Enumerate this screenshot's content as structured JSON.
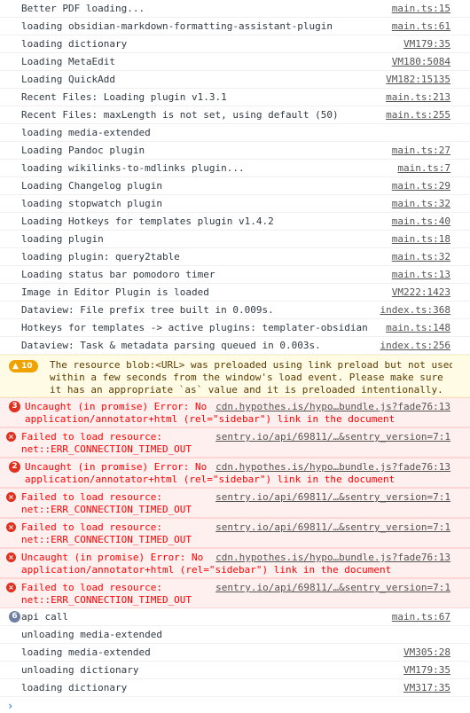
{
  "messages": [
    {
      "type": "log",
      "text": "Better PDF loading...",
      "source": "main.ts:15"
    },
    {
      "type": "log",
      "text": "loading obsidian-markdown-formatting-assistant-plugin",
      "source": "main.ts:61"
    },
    {
      "type": "log",
      "text": "loading dictionary",
      "source": "VM179:35"
    },
    {
      "type": "log",
      "text": "Loading MetaEdit",
      "source": "VM180:5084"
    },
    {
      "type": "log",
      "text": "Loading QuickAdd",
      "source": "VM182:15135"
    },
    {
      "type": "log",
      "text": "Recent Files: Loading plugin v1.3.1",
      "source": "main.ts:213"
    },
    {
      "type": "log",
      "text": "Recent Files: maxLength is not set, using default (50)",
      "source": "main.ts:255"
    },
    {
      "type": "log",
      "text": "loading media-extended",
      "source": ""
    },
    {
      "type": "log",
      "text": "Loading Pandoc plugin",
      "source": "main.ts:27"
    },
    {
      "type": "log",
      "text": "loading wikilinks-to-mdlinks plugin...",
      "source": "main.ts:7"
    },
    {
      "type": "log",
      "text": "Loading Changelog plugin",
      "source": "main.ts:29"
    },
    {
      "type": "log",
      "text": "loading stopwatch plugin",
      "source": "main.ts:32"
    },
    {
      "type": "log",
      "text": "Loading Hotkeys for templates plugin v1.4.2",
      "source": "main.ts:40"
    },
    {
      "type": "log",
      "text": "loading plugin",
      "source": "main.ts:18"
    },
    {
      "type": "log",
      "text": "loading plugin: query2table",
      "source": "main.ts:32"
    },
    {
      "type": "log",
      "text": "Loading status bar pomodoro timer",
      "source": "main.ts:13"
    },
    {
      "type": "log",
      "text": "Image in Editor Plugin is loaded",
      "source": "VM222:1423"
    },
    {
      "type": "log",
      "text": "Dataview: File prefix tree built in 0.009s.",
      "source": "index.ts:368"
    },
    {
      "type": "log",
      "text": "Hotkeys for templates -> active plugins: templater-obsidian",
      "source": "main.ts:148"
    },
    {
      "type": "log",
      "text": "Dataview: Task & metadata parsing queued in 0.003s.",
      "source": "index.ts:256"
    }
  ],
  "warning": {
    "count": "10",
    "lines": [
      "The resource blob:<URL> was preloaded using link preload but not used",
      "within a few seconds from the window's load event. Please make sure",
      "it has an appropriate `as` value and it is preloaded intentionally."
    ]
  },
  "errors": [
    {
      "badge": "3",
      "line1": "Uncaught (in promise) Error: No",
      "line2": "application/annotator+html (rel=\"sidebar\") link in the document",
      "source": "cdn.hypothes.is/hypo…bundle.js?fade76:13"
    },
    {
      "badge": "",
      "line1": "Failed to load resource:",
      "line2": "net::ERR_CONNECTION_TIMED_OUT",
      "source": "sentry.io/api/69811/…&sentry_version=7:1"
    },
    {
      "badge": "2",
      "line1": "Uncaught (in promise) Error: No",
      "line2": "application/annotator+html (rel=\"sidebar\") link in the document",
      "source": "cdn.hypothes.is/hypo…bundle.js?fade76:13"
    },
    {
      "badge": "",
      "line1": "Failed to load resource:",
      "line2": "net::ERR_CONNECTION_TIMED_OUT",
      "source": "sentry.io/api/69811/…&sentry_version=7:1"
    },
    {
      "badge": "",
      "line1": "Failed to load resource:",
      "line2": "net::ERR_CONNECTION_TIMED_OUT",
      "source": "sentry.io/api/69811/…&sentry_version=7:1"
    },
    {
      "badge": "",
      "line1": "Uncaught (in promise) Error: No",
      "line2": "application/annotator+html (rel=\"sidebar\") link in the document",
      "source": "cdn.hypothes.is/hypo…bundle.js?fade76:13"
    },
    {
      "badge": "",
      "line1": "Failed to load resource:",
      "line2": "net::ERR_CONNECTION_TIMED_OUT",
      "source": "sentry.io/api/69811/…&sentry_version=7:1"
    }
  ],
  "tail": [
    {
      "type": "info",
      "badge": "6",
      "text": "api call",
      "source": "main.ts:67"
    },
    {
      "type": "log",
      "text": "unloading media-extended",
      "source": ""
    },
    {
      "type": "log",
      "text": "loading media-extended",
      "source": "VM305:28"
    },
    {
      "type": "log",
      "text": "unloading dictionary",
      "source": "VM179:35"
    },
    {
      "type": "log",
      "text": "loading dictionary",
      "source": "VM317:35"
    }
  ],
  "prompt": {
    "glyph": "›"
  },
  "icons": {
    "error": "error-x-icon",
    "warning": "warning-triangle-icon",
    "prompt": "chevron-right-icon"
  },
  "colors": {
    "error_bg": "#fff0f0",
    "error_text": "#ff0000",
    "warning_bg": "#fffbe5",
    "warning_badge": "#f0a300",
    "info_badge": "#6e7fa6",
    "link": "#545454"
  }
}
